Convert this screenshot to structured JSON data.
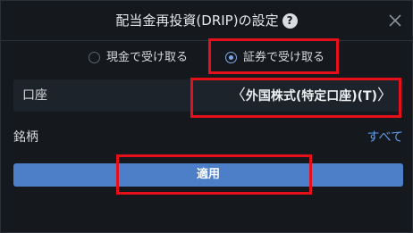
{
  "dialog": {
    "title": "配当金再投資(DRIP)の設定",
    "help_icon": "?",
    "close_icon": "close-icon"
  },
  "reinvest_options": {
    "cash_label": "現金で受け取る",
    "securities_label": "証券で受け取る",
    "selected": "securities"
  },
  "account": {
    "label": "口座",
    "value": "外国株式(特定口座)(T)",
    "prev_chevron": "〈",
    "next_chevron": "〉"
  },
  "stock": {
    "label": "銘柄",
    "value": "すべて"
  },
  "apply_button": {
    "label": "適用"
  },
  "colors": {
    "background": "#15191e",
    "accent": "#4d7fc8",
    "link": "#5f9be8",
    "highlight": "#e6101b"
  }
}
